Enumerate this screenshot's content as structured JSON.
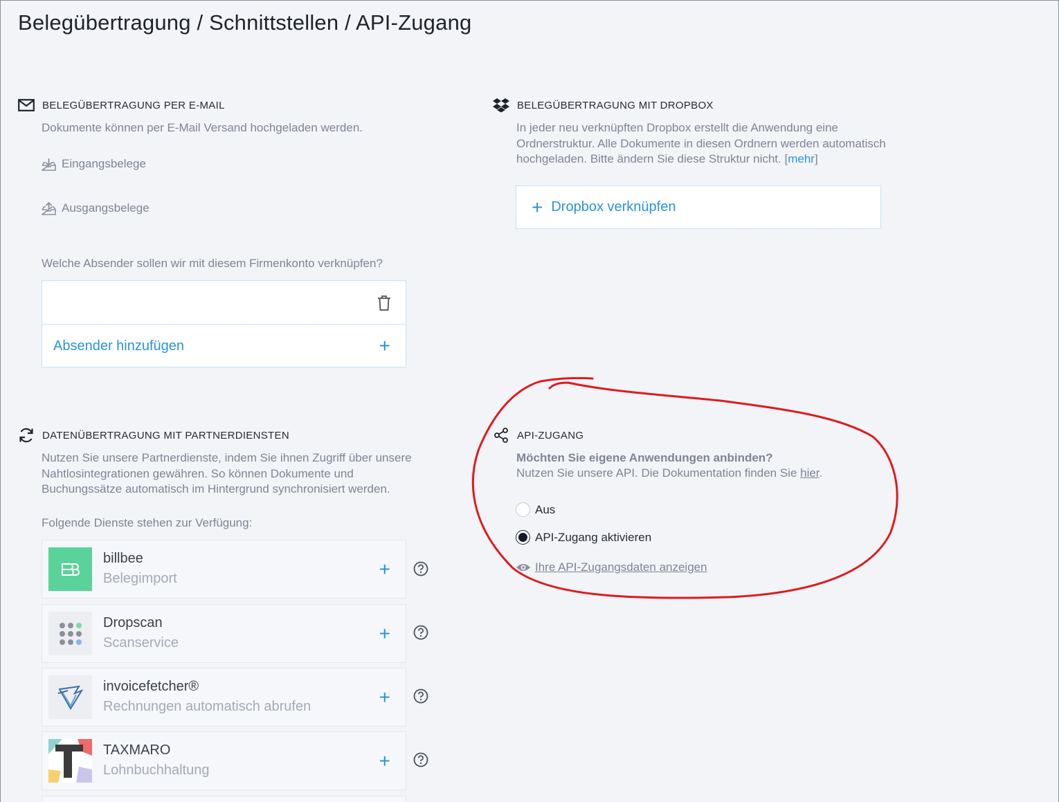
{
  "page": {
    "title": "Belegübertragung / Schnittstellen / API-Zugang"
  },
  "email_section": {
    "icon": "envelope-icon",
    "title": "BELEGÜBERTRAGUNG PER E-MAIL",
    "description": "Dokumente können per E-Mail Versand hochgeladen werden.",
    "incoming_label": "Eingangsbelege",
    "outgoing_label": "Ausgangsbelege",
    "sender_question": "Welche Absender sollen wir mit diesem Firmenkonto verknüpfen?",
    "sender_value": "",
    "add_sender_label": "Absender hinzufügen",
    "add_icon": "+"
  },
  "dropbox_section": {
    "icon": "dropbox-icon",
    "title": "BELEGÜBERTRAGUNG MIT DROPBOX",
    "description_line1": "In jeder neu verknüpften Dropbox erstellt die Anwendung eine",
    "description_line2": "Ordnerstruktur. Alle Dokumente in diesen Ordnern werden automatisch",
    "description_line3": "hochgeladen. Bitte ändern Sie diese Struktur nicht. ",
    "more_bracket_open": "[",
    "more_link": "mehr",
    "more_bracket_close": "]",
    "connect_label": "Dropbox verknüpfen",
    "connect_icon": "+"
  },
  "partner_section": {
    "icon": "sync-icon",
    "title": "DATENÜBERTRAGUNG MIT PARTNERDIENSTEN",
    "description_line1": "Nutzen Sie unsere Partnerdienste, indem Sie ihnen Zugriff über unsere",
    "description_line2": "Nahtlosintegrationen gewähren. So können Dokumente und",
    "description_line3": "Buchungssätze automatisch im Hintergrund synchronisiert werden.",
    "services_question": "Folgende Dienste stehen zur Verfügung:",
    "add_icon": "+",
    "services": [
      {
        "name": "billbee",
        "subtitle": "Belegimport",
        "logo": "billbee-logo"
      },
      {
        "name": "Dropscan",
        "subtitle": "Scanservice",
        "logo": "dropscan-logo"
      },
      {
        "name": "invoicefetcher®",
        "subtitle": "Rechnungen automatisch abrufen",
        "logo": "invoicefetcher-logo"
      },
      {
        "name": "TAXMARO",
        "subtitle": "Lohnbuchhaltung",
        "logo": "taxmaro-logo"
      }
    ]
  },
  "api_section": {
    "icon": "share-icon",
    "title": "API-ZUGANG",
    "question": "Möchten Sie eigene Anwendungen anbinden?",
    "description_prefix": "Nutzen Sie unsere API. Die Dokumentation finden Sie ",
    "doc_link": "hier",
    "description_suffix": ".",
    "options": [
      {
        "label": "Aus",
        "selected": false
      },
      {
        "label": "API-Zugang aktivieren",
        "selected": true
      }
    ],
    "show_credentials_label": "Ihre API-Zugangsdaten anzeigen"
  },
  "colors": {
    "accent": "#2a93d5",
    "muted_text": "#7d8594",
    "background": "#f3f4f7",
    "annotation": "#e0191c",
    "billbee": "#5ad39a"
  }
}
